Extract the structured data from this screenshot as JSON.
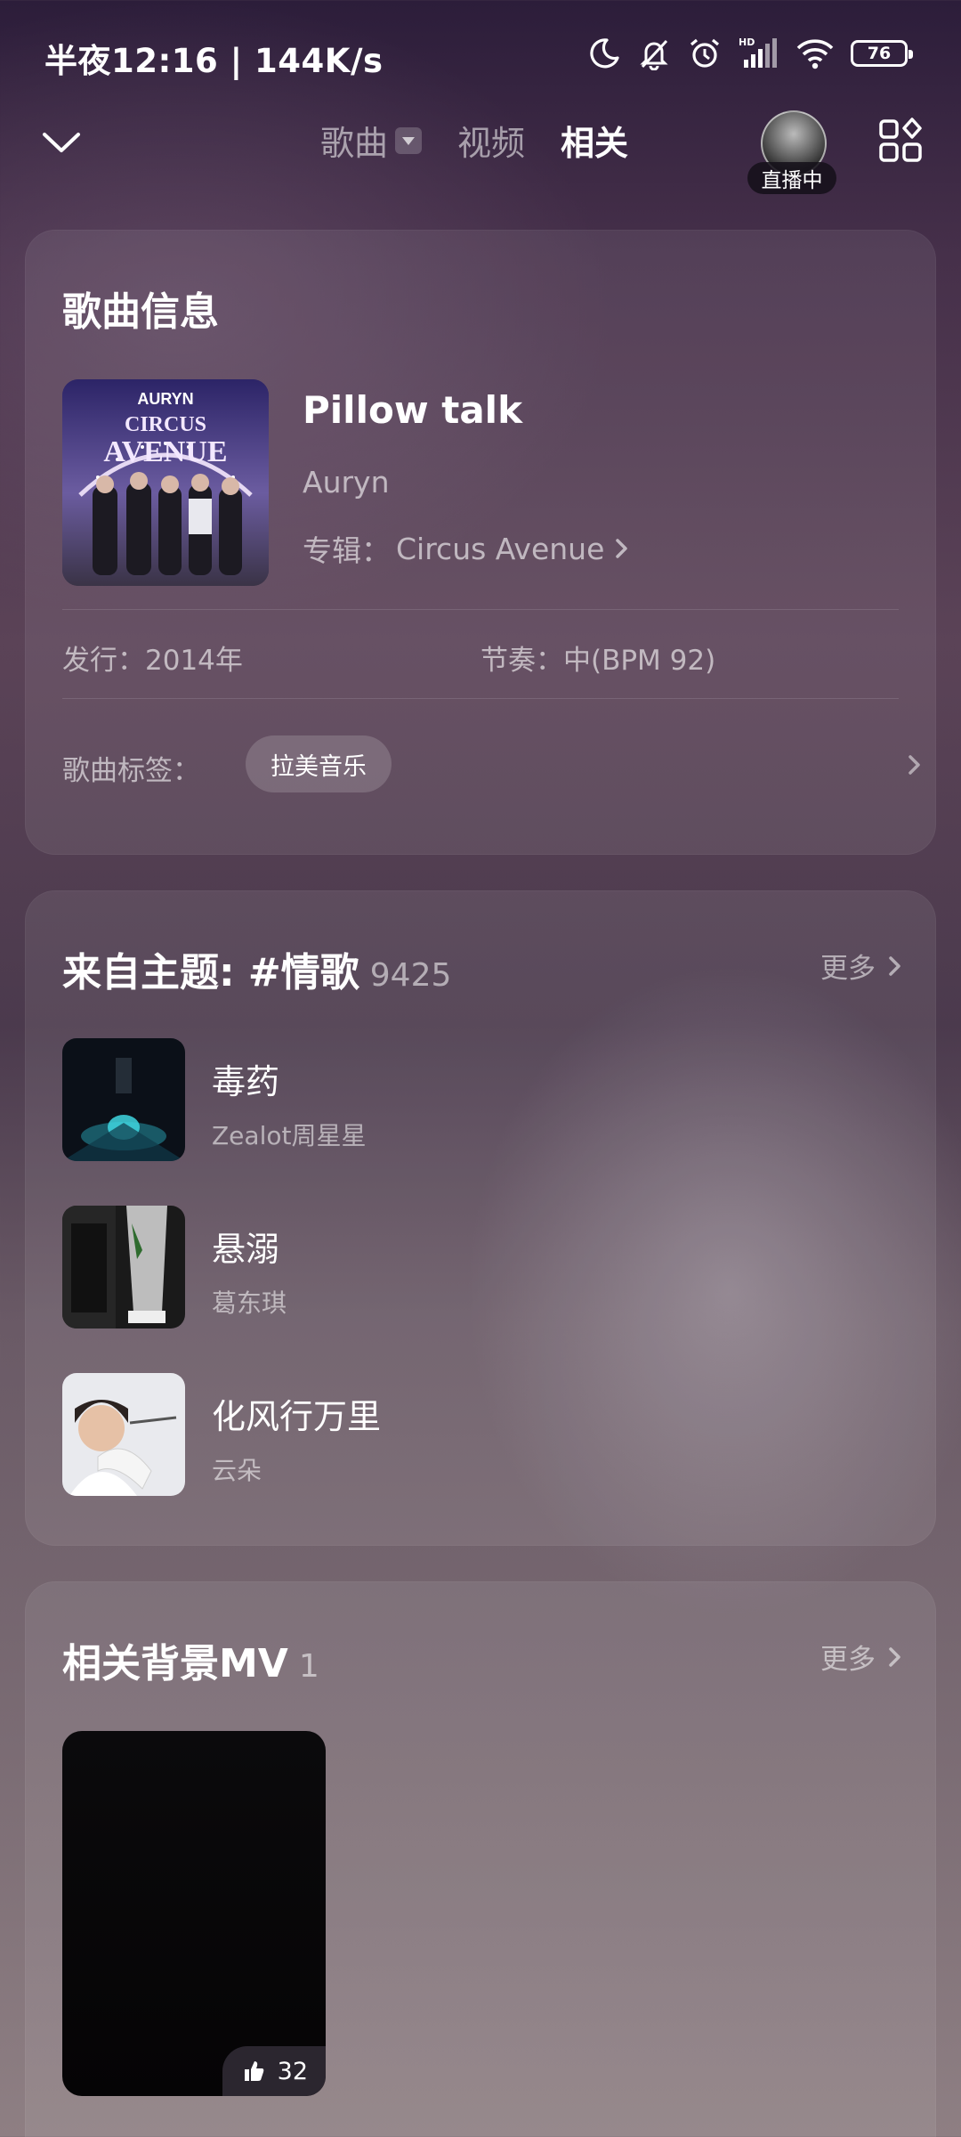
{
  "status_bar": {
    "time": "半夜12:16 | 144K/s",
    "battery": "76",
    "icons": [
      "moon-icon",
      "bell-muted-icon",
      "alarm-icon",
      "signal-icon",
      "wifi-icon",
      "battery-icon"
    ]
  },
  "nav": {
    "tabs": [
      {
        "label": "歌曲",
        "has_dropdown": true
      },
      {
        "label": "视频"
      },
      {
        "label": "相关",
        "active": true
      }
    ],
    "live_label": "直播中"
  },
  "song_info": {
    "section_title": "歌曲信息",
    "title": "Pillow talk",
    "artist": "Auryn",
    "album_prefix": "专辑：",
    "album": "Circus Avenue",
    "cover_text_top": "AURYN",
    "cover_text_1": "CIRCUS",
    "cover_text_2": "AVENUE",
    "release": "发行：2014年",
    "tempo": "节奏：中(BPM 92)",
    "tags_label": "歌曲标签：",
    "tags": [
      "拉美音乐"
    ]
  },
  "topic": {
    "section_title": "来自主题: #情歌",
    "count": "9425",
    "more_label": "更多",
    "songs": [
      {
        "title": "毒药",
        "artist": "Zealot周星星"
      },
      {
        "title": "悬溺",
        "artist": "葛东琪"
      },
      {
        "title": "化风行万里",
        "artist": "云朵"
      }
    ]
  },
  "mv": {
    "section_title": "相关背景MV",
    "count": "1",
    "more_label": "更多",
    "likes": "32"
  },
  "colors": {
    "background_top": "#2c1d3a",
    "background_bottom": "#8e7f83",
    "text_secondary": "rgba(255,255,255,0.6)"
  }
}
